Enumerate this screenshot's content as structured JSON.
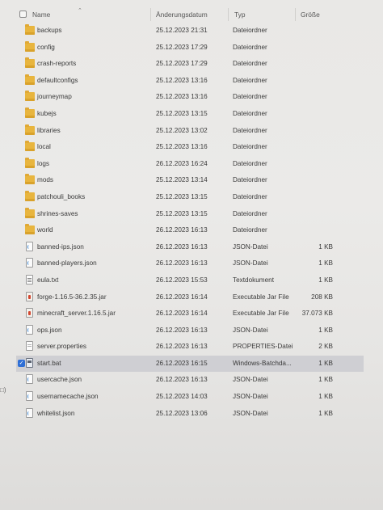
{
  "header": {
    "name": "Name",
    "date": "Änderungsdatum",
    "type": "Typ",
    "size": "Größe",
    "sort_icon": "chevron-up-icon"
  },
  "left_edge_text": "□)",
  "rows": [
    {
      "name": "backups",
      "date": "25.12.2023 21:31",
      "type": "Dateiordner",
      "size": "",
      "icon": "folder-icon"
    },
    {
      "name": "config",
      "date": "25.12.2023 17:29",
      "type": "Dateiordner",
      "size": "",
      "icon": "folder-icon"
    },
    {
      "name": "crash-reports",
      "date": "25.12.2023 17:29",
      "type": "Dateiordner",
      "size": "",
      "icon": "folder-icon"
    },
    {
      "name": "defaultconfigs",
      "date": "25.12.2023 13:16",
      "type": "Dateiordner",
      "size": "",
      "icon": "folder-icon"
    },
    {
      "name": "journeymap",
      "date": "25.12.2023 13:16",
      "type": "Dateiordner",
      "size": "",
      "icon": "folder-icon"
    },
    {
      "name": "kubejs",
      "date": "25.12.2023 13:15",
      "type": "Dateiordner",
      "size": "",
      "icon": "folder-icon"
    },
    {
      "name": "libraries",
      "date": "25.12.2023 13:02",
      "type": "Dateiordner",
      "size": "",
      "icon": "folder-icon"
    },
    {
      "name": "local",
      "date": "25.12.2023 13:16",
      "type": "Dateiordner",
      "size": "",
      "icon": "folder-icon"
    },
    {
      "name": "logs",
      "date": "26.12.2023 16:24",
      "type": "Dateiordner",
      "size": "",
      "icon": "folder-icon"
    },
    {
      "name": "mods",
      "date": "25.12.2023 13:14",
      "type": "Dateiordner",
      "size": "",
      "icon": "folder-icon"
    },
    {
      "name": "patchouli_books",
      "date": "25.12.2023 13:15",
      "type": "Dateiordner",
      "size": "",
      "icon": "folder-icon"
    },
    {
      "name": "shrines-saves",
      "date": "25.12.2023 13:15",
      "type": "Dateiordner",
      "size": "",
      "icon": "folder-icon"
    },
    {
      "name": "world",
      "date": "26.12.2023 16:13",
      "type": "Dateiordner",
      "size": "",
      "icon": "folder-icon"
    },
    {
      "name": "banned-ips.json",
      "date": "26.12.2023 16:13",
      "type": "JSON-Datei",
      "size": "1 KB",
      "icon": "json-file-icon"
    },
    {
      "name": "banned-players.json",
      "date": "26.12.2023 16:13",
      "type": "JSON-Datei",
      "size": "1 KB",
      "icon": "json-file-icon"
    },
    {
      "name": "eula.txt",
      "date": "26.12.2023 15:53",
      "type": "Textdokument",
      "size": "1 KB",
      "icon": "text-file-icon"
    },
    {
      "name": "forge-1.16.5-36.2.35.jar",
      "date": "26.12.2023 16:14",
      "type": "Executable Jar File",
      "size": "208 KB",
      "icon": "jar-file-icon"
    },
    {
      "name": "minecraft_server.1.16.5.jar",
      "date": "26.12.2023 16:14",
      "type": "Executable Jar File",
      "size": "37.073 KB",
      "icon": "jar-file-icon"
    },
    {
      "name": "ops.json",
      "date": "26.12.2023 16:13",
      "type": "JSON-Datei",
      "size": "1 KB",
      "icon": "json-file-icon"
    },
    {
      "name": "server.properties",
      "date": "26.12.2023 16:13",
      "type": "PROPERTIES-Datei",
      "size": "2 KB",
      "icon": "properties-file-icon"
    },
    {
      "name": "start.bat",
      "date": "26.12.2023 16:15",
      "type": "Windows-Batchda...",
      "size": "1 KB",
      "icon": "batch-file-icon",
      "selected": true
    },
    {
      "name": "usercache.json",
      "date": "26.12.2023 16:13",
      "type": "JSON-Datei",
      "size": "1 KB",
      "icon": "json-file-icon"
    },
    {
      "name": "usernamecache.json",
      "date": "25.12.2023 14:03",
      "type": "JSON-Datei",
      "size": "1 KB",
      "icon": "json-file-icon"
    },
    {
      "name": "whitelist.json",
      "date": "25.12.2023 13:06",
      "type": "JSON-Datei",
      "size": "1 KB",
      "icon": "json-file-icon"
    }
  ],
  "colors": {
    "folder": "#e8b53e",
    "selection": "#cfcfd3",
    "checkbox_accent": "#2f6fd6"
  }
}
